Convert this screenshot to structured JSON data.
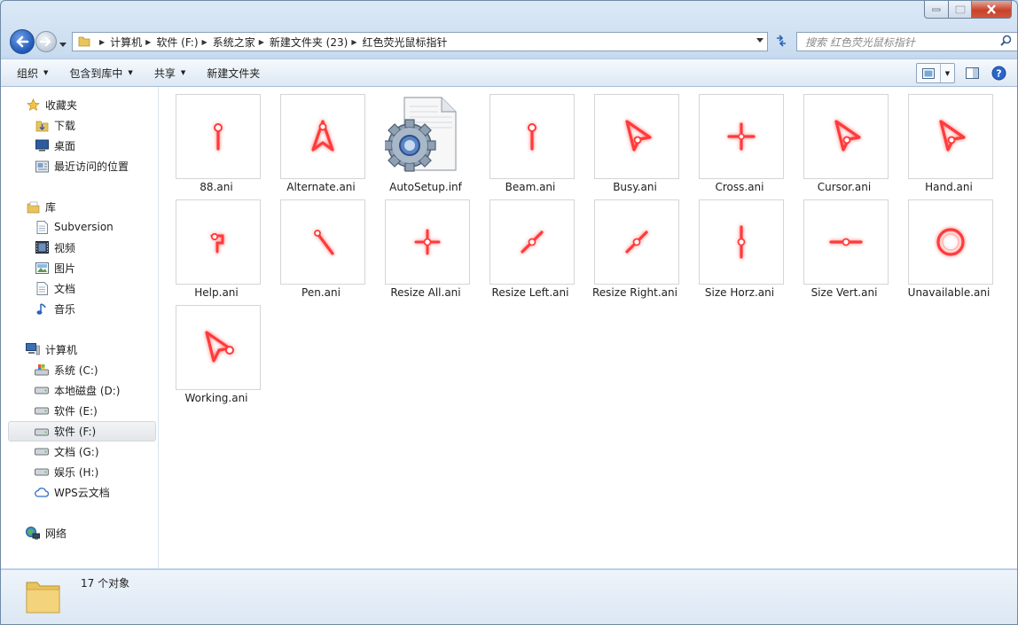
{
  "window": {
    "colors": {
      "accent": "#1f57b6",
      "close": "#c7432b",
      "glow": "#ff3b3b"
    }
  },
  "nav": {
    "breadcrumb": [
      "计算机",
      "软件 (F:)",
      "系统之家",
      "新建文件夹 (23)",
      "红色荧光鼠标指针"
    ],
    "search_placeholder": "搜索 红色荧光鼠标指针"
  },
  "toolbar": {
    "organize": "组织",
    "include_in_library": "包含到库中",
    "share": "共享",
    "new_folder": "新建文件夹"
  },
  "sidebar": {
    "favorites": {
      "label": "收藏夹",
      "items": [
        "下载",
        "桌面",
        "最近访问的位置"
      ]
    },
    "libraries": {
      "label": "库",
      "items": [
        "Subversion",
        "视频",
        "图片",
        "文档",
        "音乐"
      ]
    },
    "computer": {
      "label": "计算机",
      "items": [
        "系统 (C:)",
        "本地磁盘 (D:)",
        "软件 (E:)",
        "软件 (F:)",
        "文档 (G:)",
        "娱乐 (H:)",
        "WPS云文档"
      ],
      "selected": "软件 (F:)"
    },
    "network": {
      "label": "网络"
    }
  },
  "files": [
    {
      "name": "88.ani",
      "icon": "beam-cursor-icon"
    },
    {
      "name": "Alternate.ani",
      "icon": "alternate-arrow-cursor-icon"
    },
    {
      "name": "AutoSetup.inf",
      "icon": "setup-inf-file-icon"
    },
    {
      "name": "Beam.ani",
      "icon": "beam-cursor-icon"
    },
    {
      "name": "Busy.ani",
      "icon": "arrow-cursor-icon"
    },
    {
      "name": "Cross.ani",
      "icon": "crosshair-cursor-icon"
    },
    {
      "name": "Cursor.ani",
      "icon": "arrow-cursor-icon"
    },
    {
      "name": "Hand.ani",
      "icon": "arrow-cursor-icon"
    },
    {
      "name": "Help.ani",
      "icon": "help-cursor-icon"
    },
    {
      "name": "Pen.ani",
      "icon": "pen-cursor-icon"
    },
    {
      "name": "Resize All.ani",
      "icon": "move-cursor-icon"
    },
    {
      "name": "Resize Left.ani",
      "icon": "diagonal-resize-cursor-icon"
    },
    {
      "name": "Resize Right.ani",
      "icon": "diagonal-resize-cursor-icon"
    },
    {
      "name": "Size Horz.ani",
      "icon": "vertical-resize-cursor-icon"
    },
    {
      "name": "Size Vert.ani",
      "icon": "horizontal-resize-cursor-icon"
    },
    {
      "name": "Unavailable.ani",
      "icon": "unavailable-cursor-icon"
    },
    {
      "name": "Working.ani",
      "icon": "working-arrow-cursor-icon"
    }
  ],
  "status": {
    "count": "17 个对象"
  }
}
